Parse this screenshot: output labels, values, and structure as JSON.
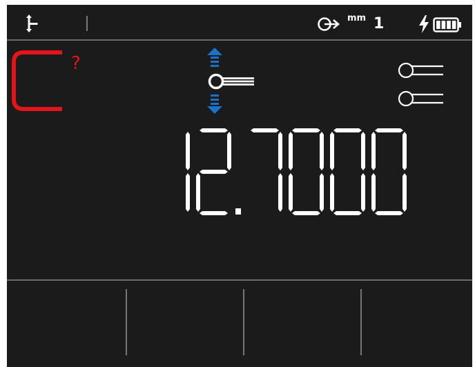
{
  "status_bar": {
    "axis_icon": "axis-icon",
    "resolution_icon": "probe-resolution-icon",
    "unit": "mm",
    "resolution": "1",
    "charging_icon": "lightning-icon",
    "battery_icon": "battery-icon",
    "battery_level": 1.0
  },
  "measurement": {
    "reference_status_icon": "reference-bracket-icon",
    "reference_status_color": "#e3141b",
    "reference_unknown_mark": "?",
    "move_direction_icon": "up-down-arrows-icon",
    "move_direction_color": "#1a73c8",
    "probe_icon": "probe-icon",
    "mode_icon": "dual-probe-icon",
    "display_value": "12.7000"
  },
  "softkeys": [
    {
      "name": "softkey-1",
      "label": ""
    },
    {
      "name": "softkey-2",
      "label": ""
    },
    {
      "name": "softkey-3",
      "label": ""
    },
    {
      "name": "softkey-4",
      "label": ""
    }
  ]
}
